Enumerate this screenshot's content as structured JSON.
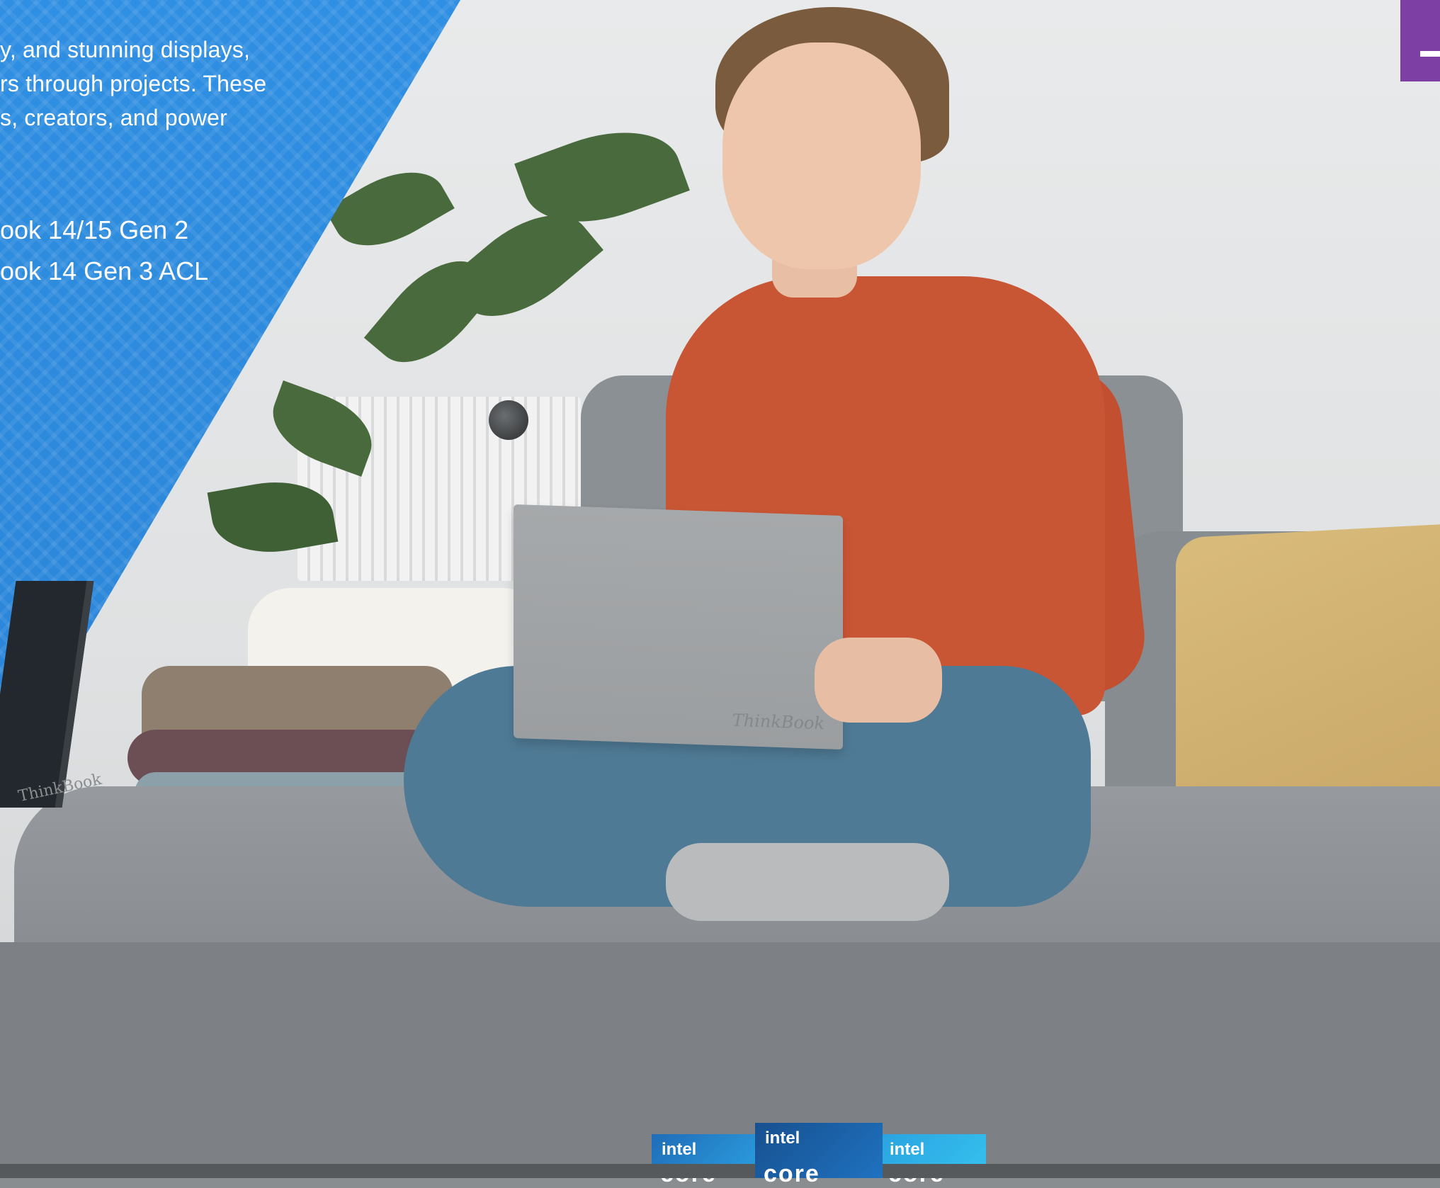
{
  "intro": {
    "line1": "y, and stunning displays,",
    "line2": "rs through projects. These",
    "line3": "s, creators, and power"
  },
  "models": [
    "ook 14/15 Gen 2",
    "ook 14 Gen 3 ACL"
  ],
  "laptop_brand": "ThinkBook",
  "left_laptop_brand": "ThinkBook",
  "intel_logos": [
    {
      "brand": "intel",
      "label": "core"
    },
    {
      "brand": "intel",
      "label": "core"
    },
    {
      "brand": "intel",
      "label": "core"
    }
  ],
  "colors": {
    "blue_panel": "#2b86d9",
    "badge_purple": "#7e3fa5",
    "sweater": "#c85635",
    "jeans": "#4f7a95",
    "sofa": "#8a8e92"
  }
}
